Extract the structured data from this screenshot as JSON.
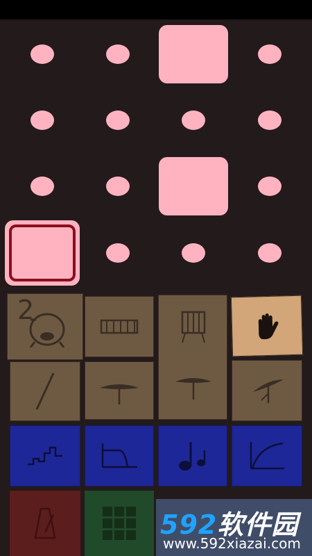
{
  "colors": {
    "background": "#231a1b",
    "step_on": "#ffb3c1",
    "step_selected_border": "#8b0e1e",
    "drum_tile": "#6e5a43",
    "drum_tile_active": "#d2a678",
    "fx_tile": "#1e2797"
  },
  "step_grid": {
    "rows": [
      [
        "off",
        "off",
        "on",
        "off"
      ],
      [
        "off",
        "off",
        "off",
        "off"
      ],
      [
        "off",
        "off",
        "on",
        "off"
      ],
      [
        "on-selected",
        "off",
        "off",
        "off"
      ]
    ]
  },
  "drum_pads": {
    "kick_number": "2",
    "pads": [
      "kick-drum-icon",
      "snare-drum-icon",
      "floor-tom-icon",
      "hand-icon",
      "drum-stick-icon",
      "cymbal-icon",
      "hi-hat-icon",
      "crash-cymbal-icon"
    ],
    "active": "hand-icon"
  },
  "effect_pads": [
    "staircase-envelope-icon",
    "low-pass-filter-icon",
    "music-notes-icon",
    "curve-envelope-icon"
  ],
  "bottom_pads": [
    "metronome-icon",
    "grid-icon"
  ],
  "watermark": {
    "brand_number": "592",
    "brand_text": "软件园",
    "url": "www.592xiazai.com"
  }
}
